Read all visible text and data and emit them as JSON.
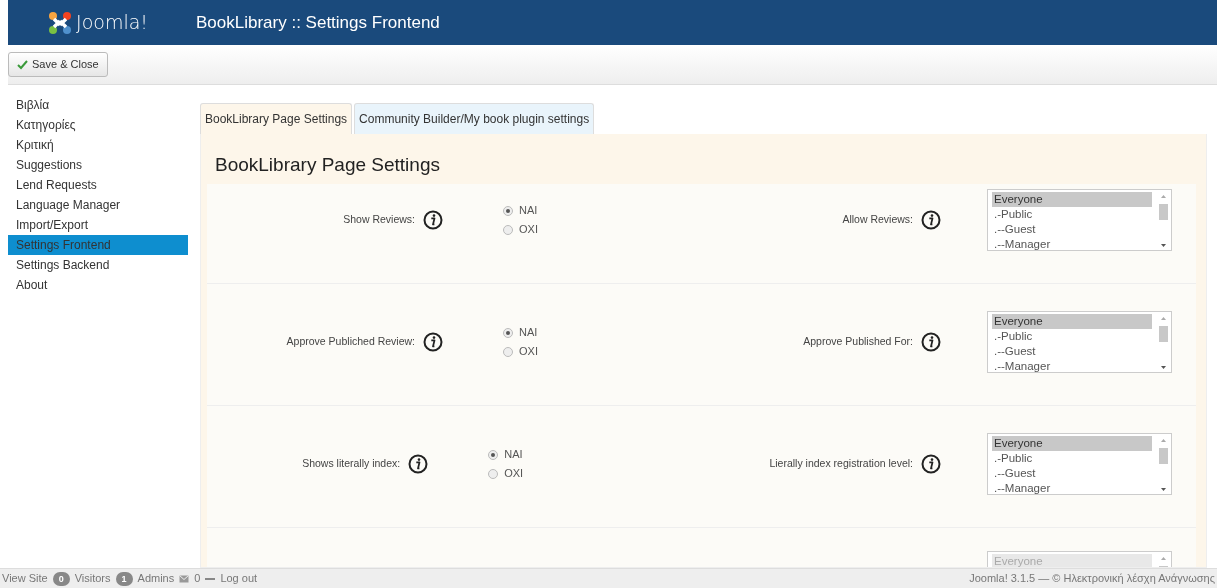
{
  "header": {
    "logo_text": "Joomla!",
    "title": "BookLibrary :: Settings Frontend"
  },
  "toolbar": {
    "buttons": [
      {
        "label": "Save & Close"
      }
    ]
  },
  "sidebar": {
    "items": [
      {
        "label": "Βιβλία",
        "selected": false
      },
      {
        "label": "Κατηγορίες",
        "selected": false
      },
      {
        "label": "Κριτική",
        "selected": false
      },
      {
        "label": "Suggestions",
        "selected": false
      },
      {
        "label": "Lend Requests",
        "selected": false
      },
      {
        "label": "Language Manager",
        "selected": false
      },
      {
        "label": "Import/Export",
        "selected": false
      },
      {
        "label": "Settings Frontend",
        "selected": true
      },
      {
        "label": "Settings Backend",
        "selected": false
      },
      {
        "label": "About",
        "selected": false
      }
    ]
  },
  "tabs": [
    {
      "label": "BookLibrary Page Settings",
      "selected": true
    },
    {
      "label": "Community Builder/My book plugin settings",
      "selected": false
    }
  ],
  "panel_title": "BookLibrary Page Settings",
  "rows": [
    {
      "left_label": "Show Reviews:",
      "radios": [
        {
          "label": "NAI",
          "selected": true
        },
        {
          "label": "OXI",
          "selected": false
        }
      ],
      "right_label": "Allow Reviews:",
      "options": [
        {
          "label": "Everyone",
          "selected": true
        },
        {
          "label": ".-Public",
          "selected": false
        },
        {
          "label": ".--Guest",
          "selected": false
        },
        {
          "label": ".--Manager",
          "selected": false
        }
      ]
    },
    {
      "left_label": "Approve Publiched Review:",
      "radios": [
        {
          "label": "NAI",
          "selected": true
        },
        {
          "label": "OXI",
          "selected": false
        }
      ],
      "right_label": "Approve Published For:",
      "options": [
        {
          "label": "Everyone",
          "selected": true
        },
        {
          "label": ".-Public",
          "selected": false
        },
        {
          "label": ".--Guest",
          "selected": false
        },
        {
          "label": ".--Manager",
          "selected": false
        }
      ]
    },
    {
      "left_label": "Shows literally index:",
      "radios": [
        {
          "label": "NAI",
          "selected": true
        },
        {
          "label": "OXI",
          "selected": false
        }
      ],
      "right_label": "Lierally index registration level:",
      "options": [
        {
          "label": "Everyone",
          "selected": true
        },
        {
          "label": ".-Public",
          "selected": false
        },
        {
          "label": ".--Guest",
          "selected": false
        },
        {
          "label": ".--Manager",
          "selected": false
        }
      ]
    },
    {
      "options": [
        {
          "label": "Everyone",
          "selected": true
        }
      ],
      "disabled": true
    }
  ],
  "status_bar": {
    "view_site": "View Site",
    "visitors_count": "0",
    "visitors": "Visitors",
    "admins_count": "1",
    "admins": "Admins",
    "messages": "0",
    "logout": "Log out",
    "copyright": "Joomla! 3.1.5 — © Ηλεκτρονική λέσχη Ανάγνωσης"
  }
}
